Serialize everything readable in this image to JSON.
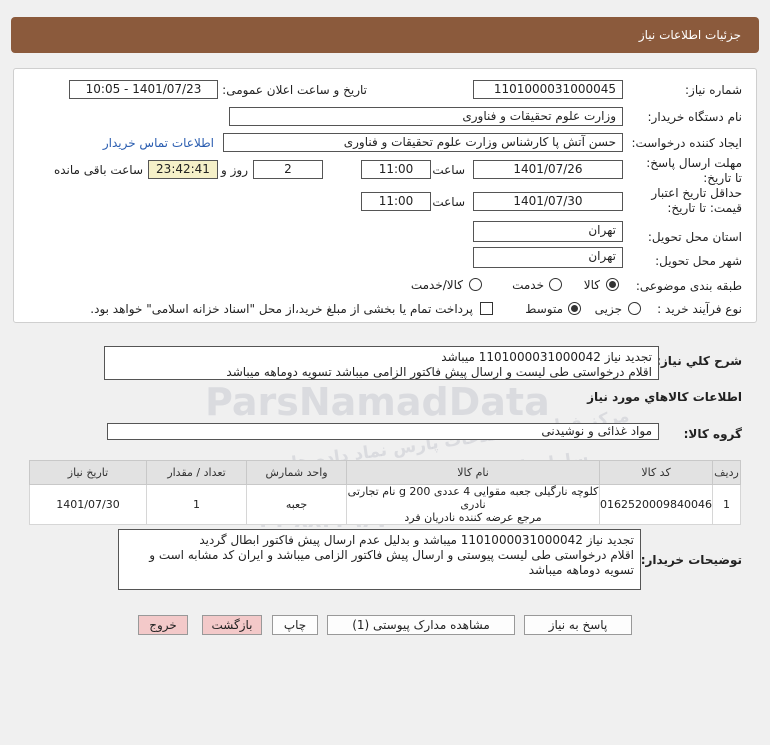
{
  "header": {
    "title": "جزئیات اطلاعات نیاز"
  },
  "labels": {
    "need_number": "شماره نیاز:",
    "announce_datetime": "تاریخ و ساعت اعلان عمومی:",
    "buyer_org": "نام دستگاه خریدار:",
    "requester": "ایجاد کننده درخواست:",
    "buyer_contact": "اطلاعات تماس خریدار",
    "reply_deadline": "مهلت ارسال پاسخ: تا تاریخ:",
    "time": "ساعت",
    "day_and": "روز و",
    "remaining": "ساعت باقی مانده",
    "price_validity": "حداقل تاریخ اعتبار قیمت: تا تاریخ:",
    "delivery_province": "استان محل تحویل:",
    "delivery_city": "شهر محل تحویل:",
    "category": "طبقه بندی موضوعی:",
    "purchase_type": "نوع فرآیند خرید :",
    "treasury_note": "پرداخت تمام یا بخشی از مبلغ خرید،از محل \"اسناد خزانه اسلامی\" خواهد بود.",
    "description": "شرح کلي نياز:",
    "goods_info": "اطلاعات کالاهاي مورد نياز",
    "goods_group": "گروه کالا:",
    "buyer_notes": "توضیحات خریدار:"
  },
  "values": {
    "need_number": "1101000031000045",
    "announce_datetime": "1401/07/23 - 10:05",
    "buyer_org": "وزارت علوم  تحقیقات و فناوری",
    "requester": "حسن آتش پا کارشناس وزارت علوم  تحقیقات و فناوری",
    "reply_date": "1401/07/26",
    "reply_time": "11:00",
    "days": "2",
    "remaining_time": "23:42:41",
    "validity_date": "1401/07/30",
    "validity_time": "11:00",
    "province": "تهران",
    "city": "تهران",
    "goods_group": "مواد غذائی و نوشیدنی"
  },
  "category_options": [
    "کالا",
    "خدمت",
    "کالا/خدمت"
  ],
  "category_selected": "کالا",
  "purchase_options": [
    "جزیی",
    "متوسط"
  ],
  "purchase_selected": "متوسط",
  "description_lines": [
    "تجدید نیاز 1101000031000042 میباشد",
    "اقلام درخواستی طی لیست   و ارسال پیش فاکتور الزامی میباشد  تسویه دوماهه میباشد"
  ],
  "table": {
    "headers": [
      "ردیف",
      "کد کالا",
      "نام کالا",
      "واحد شمارش",
      "تعداد / مقدار",
      "تاریخ نیاز"
    ],
    "rows": [
      {
        "index": "1",
        "code": "0162520009840046",
        "name_line1": "کلوچه نارگیلی جعبه مقوایی 4 عددی 200 g نام تجارتی نادری",
        "name_line2": "مرجع عرضه کننده نادریان فرد",
        "unit": "جعبه",
        "qty": "1",
        "date": "1401/07/30"
      }
    ]
  },
  "notes_lines": [
    "تجدید نیاز 1101000031000042 میباشد و بدلیل عدم ارسال پیش  فاکتور  ابطال گردید",
    "اقلام  درخواستی طی لیست پیوستی  و ارسال پیش فاکتور الزامی میباشد و ایران کد مشابه است و",
    "تسویه دوماهه میباشد"
  ],
  "buttons": {
    "reply": "پاسخ به نیاز",
    "attachments": "مشاهده مدارک پیوستی (1)",
    "print": "چاپ",
    "back": "بازگشت",
    "exit": "خروج"
  },
  "watermark": {
    "brand": "ParsNamadData",
    "line1": "مرکز فراوری اطلاعات پارس نماد داده ها",
    "line2": "سامانه اطلاع رسانی مناقصه و مزایده",
    "phone": "۰۲۱-۸۸۳۴۹۶۷۰"
  },
  "colors": {
    "title_bar": "#8b5a3c",
    "link": "#2a5db0",
    "timer_bg": "#f5f0c8",
    "pink_button": "#f3c9c9"
  }
}
